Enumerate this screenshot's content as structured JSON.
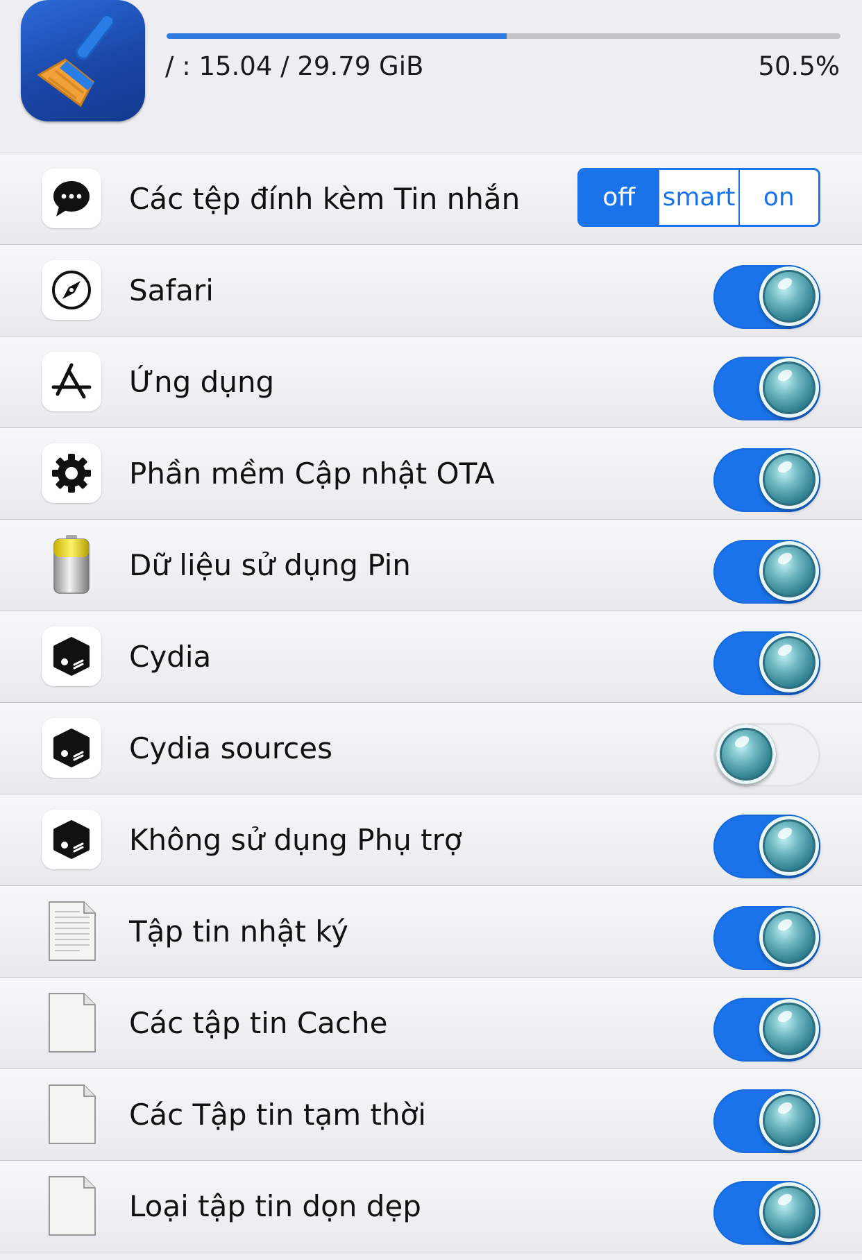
{
  "header": {
    "app_icon": "broom-icon",
    "storage_label": "/ : 15.04 / 29.79 GiB",
    "storage_percent": "50.5%",
    "progress": 0.505
  },
  "rows": [
    {
      "icon": "message-bubble-icon",
      "label": "Các tệp đính kèm Tin nhắn",
      "control": "segmented",
      "segments": [
        "off",
        "smart",
        "on"
      ],
      "selected": "off"
    },
    {
      "icon": "compass-icon",
      "label": "Safari",
      "control": "toggle",
      "state": "on"
    },
    {
      "icon": "app-store-icon",
      "label": "Ứng dụng",
      "control": "toggle",
      "state": "on"
    },
    {
      "icon": "gear-icon",
      "label": "Phần mềm Cập nhật OTA",
      "control": "toggle",
      "state": "on"
    },
    {
      "icon": "battery-icon",
      "label": "Dữ liệu sử dụng Pin",
      "control": "toggle",
      "state": "on"
    },
    {
      "icon": "cydia-box-icon",
      "label": "Cydia",
      "control": "toggle",
      "state": "on"
    },
    {
      "icon": "cydia-box-icon",
      "label": "Cydia sources",
      "control": "toggle",
      "state": "off"
    },
    {
      "icon": "cydia-box-icon",
      "label": "Không sử dụng Phụ trợ",
      "control": "toggle",
      "state": "on"
    },
    {
      "icon": "text-file-icon",
      "label": "Tập tin nhật ký",
      "control": "toggle",
      "state": "on"
    },
    {
      "icon": "blank-file-icon",
      "label": "Các tập tin Cache",
      "control": "toggle",
      "state": "on"
    },
    {
      "icon": "blank-file-icon",
      "label": "Các Tập tin tạm thời",
      "control": "toggle",
      "state": "on"
    },
    {
      "icon": "blank-file-icon",
      "label": "Loại tập tin dọn dẹp",
      "control": "toggle",
      "state": "on"
    }
  ],
  "colors": {
    "accent": "#1a73ea",
    "progress_fill": "#2e7be0",
    "background": "#eeeef2"
  }
}
